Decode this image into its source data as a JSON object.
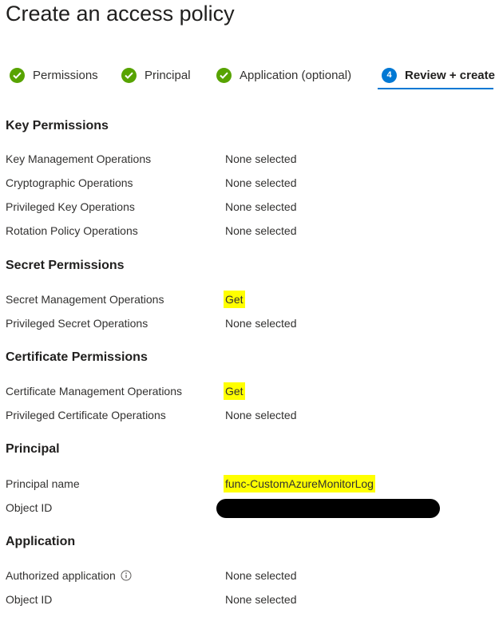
{
  "page": {
    "title": "Create an access policy"
  },
  "wizard": {
    "steps": [
      {
        "label": "Permissions",
        "status": "complete",
        "icon": "checkmark-circle-icon"
      },
      {
        "label": "Principal",
        "status": "complete",
        "icon": "checkmark-circle-icon"
      },
      {
        "label": "Application (optional)",
        "status": "complete",
        "icon": "checkmark-circle-icon"
      },
      {
        "label": "Review + create",
        "status": "current",
        "number": "4"
      }
    ],
    "active_color": "#0078d4",
    "complete_color": "#57a300"
  },
  "sections": {
    "key_permissions": {
      "title": "Key Permissions",
      "rows": [
        {
          "label": "Key Management Operations",
          "value": "None selected"
        },
        {
          "label": "Cryptographic Operations",
          "value": "None selected"
        },
        {
          "label": "Privileged Key Operations",
          "value": "None selected"
        },
        {
          "label": "Rotation Policy Operations",
          "value": "None selected"
        }
      ]
    },
    "secret_permissions": {
      "title": "Secret Permissions",
      "rows": [
        {
          "label": "Secret Management Operations",
          "value": "Get",
          "highlighted": true
        },
        {
          "label": "Privileged Secret Operations",
          "value": "None selected"
        }
      ]
    },
    "certificate_permissions": {
      "title": "Certificate Permissions",
      "rows": [
        {
          "label": "Certificate Management Operations",
          "value": "Get",
          "highlighted": true
        },
        {
          "label": "Privileged Certificate Operations",
          "value": "None selected"
        }
      ]
    },
    "principal": {
      "title": "Principal",
      "rows": [
        {
          "label": "Principal name",
          "value": "func-CustomAzureMonitorLog",
          "highlighted": true
        },
        {
          "label": "Object ID",
          "value": "",
          "redacted": true
        }
      ]
    },
    "application": {
      "title": "Application",
      "rows": [
        {
          "label": "Authorized application",
          "value": "None selected",
          "info_icon": "info-icon"
        },
        {
          "label": "Object ID",
          "value": "None selected"
        }
      ]
    }
  },
  "highlight_color": "#ffff00"
}
